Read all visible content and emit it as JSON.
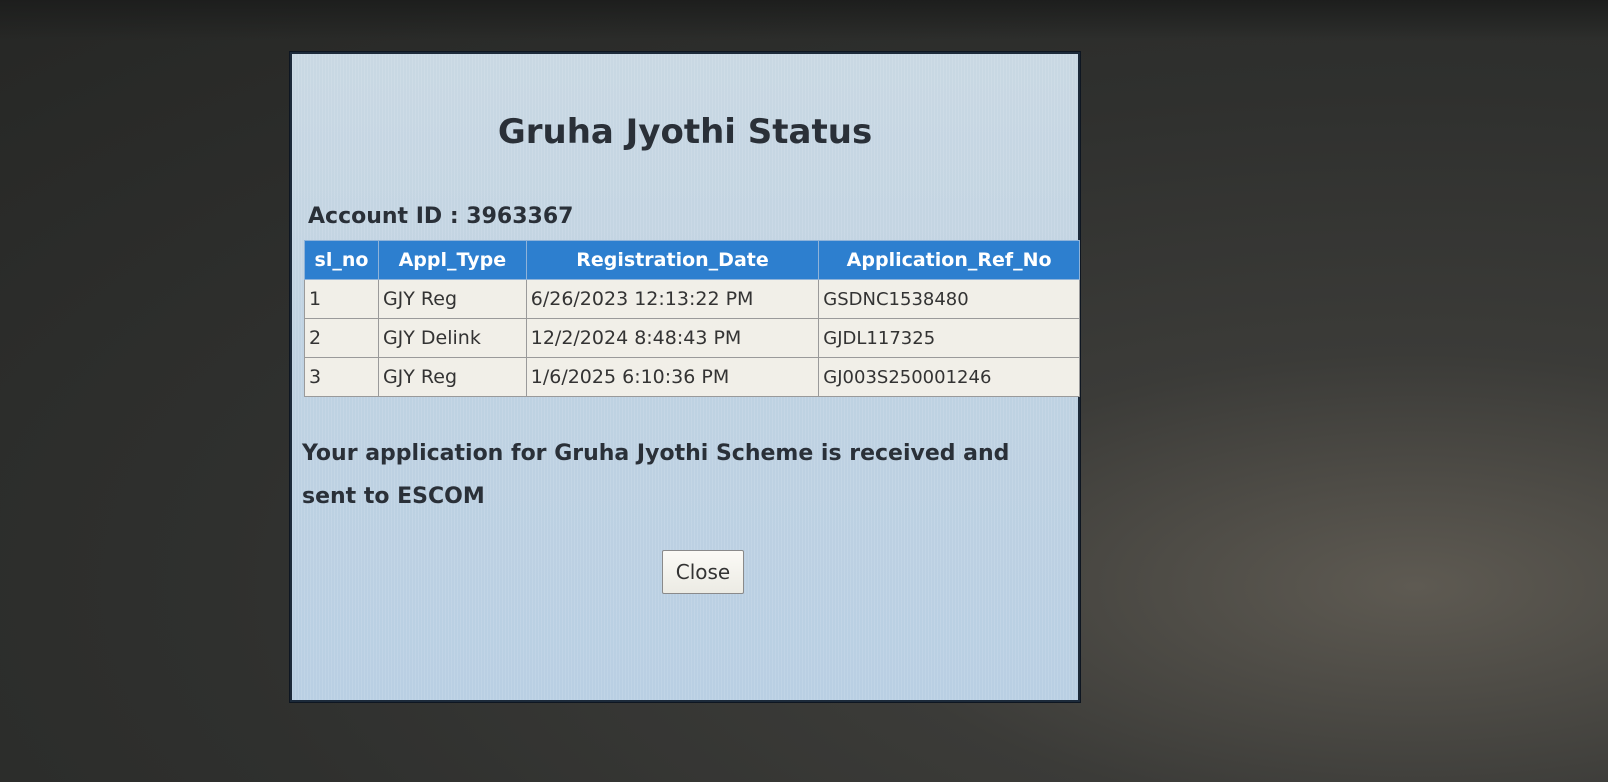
{
  "dialog": {
    "title": "Gruha Jyothi Status",
    "account_label": "Account ID : ",
    "account_id": "3963367",
    "table": {
      "headers": [
        "sl_no",
        "Appl_Type",
        "Registration_Date",
        "Application_Ref_No"
      ],
      "rows": [
        [
          "1",
          "GJY Reg",
          "6/26/2023 12:13:22 PM",
          "GSDNC1538480"
        ],
        [
          "2",
          "GJY Delink",
          "12/2/2024 8:48:43 PM",
          "GJDL117325"
        ],
        [
          "3",
          "GJY Reg",
          "1/6/2025 6:10:36 PM",
          "GJ003S250001246"
        ]
      ]
    },
    "message": "Your application for Gruha Jyothi Scheme is received and sent to ESCOM",
    "close_label": "Close"
  },
  "colors": {
    "header_bg": "#2d7fcf",
    "dialog_bg": "#c2d5e4",
    "cell_bg": "#f1efe8"
  }
}
